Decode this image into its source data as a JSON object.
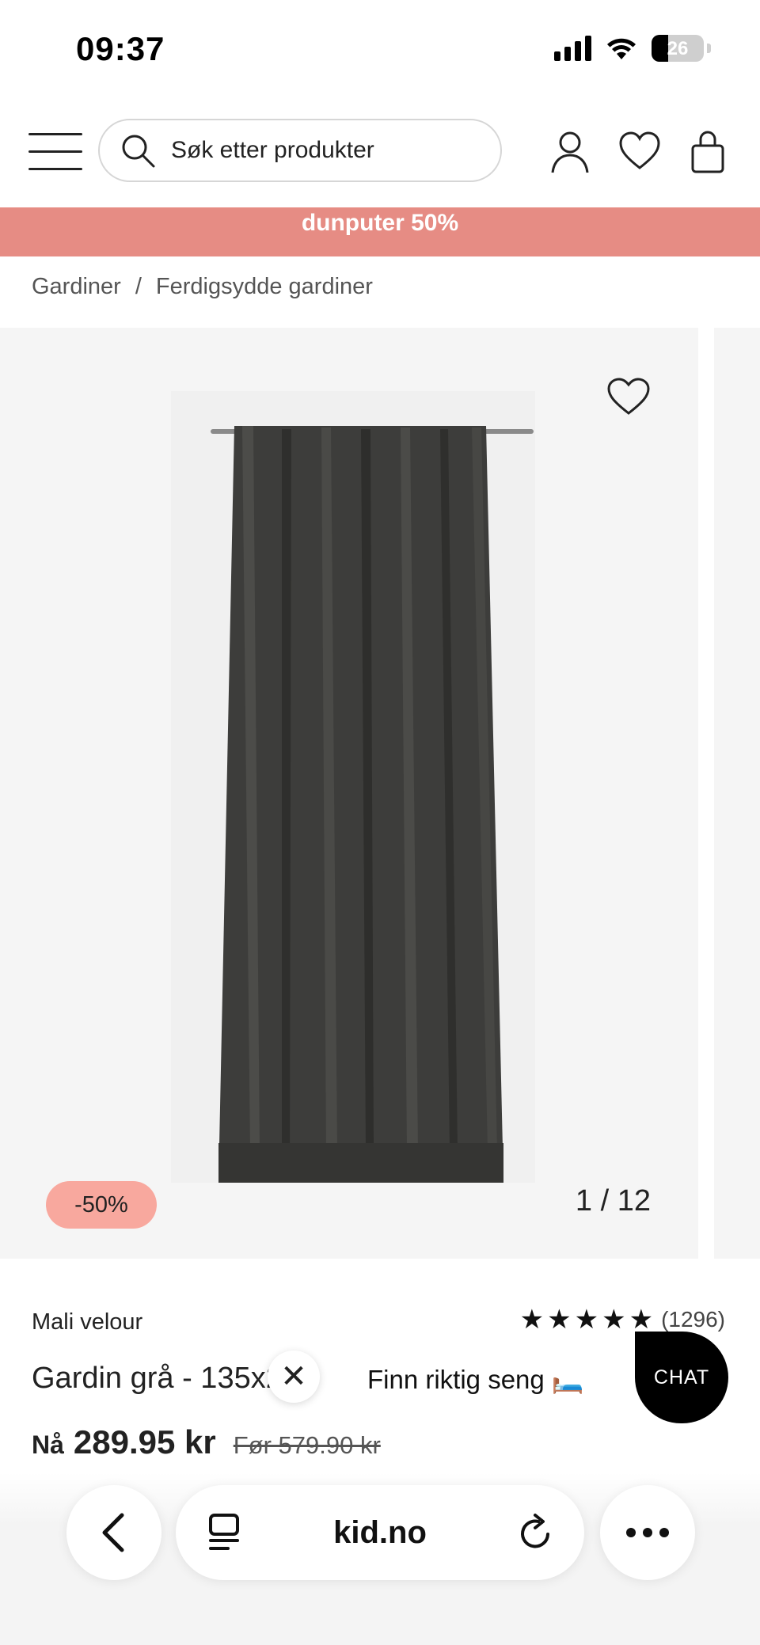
{
  "status_bar": {
    "time": "09:37",
    "battery": "26"
  },
  "header": {
    "search_placeholder": "Søk etter produkter"
  },
  "promo": {
    "text": "dunputer 50%"
  },
  "breadcrumb": {
    "items": [
      "Gardiner",
      "Ferdigsydde gardiner"
    ],
    "separator": "/"
  },
  "gallery": {
    "discount_badge": "-50%",
    "counter": "1 / 12"
  },
  "product": {
    "brand": "Mali velour",
    "rating_stars": 5,
    "rating_count": "(1296)",
    "title": "Gardin grå - 135x20",
    "price_prefix": "Nå",
    "price_now": "289.95 kr",
    "price_old": "Før 579.90 kr"
  },
  "overlay": {
    "close_glyph": "✕",
    "bed_chip": "Finn riktig seng 🛏️",
    "chat_label": "CHAT"
  },
  "browser": {
    "domain": "kid.no"
  },
  "colors": {
    "promo_bg": "#e68c84",
    "badge_bg": "#f8a89e",
    "chat_bg": "#000000"
  }
}
